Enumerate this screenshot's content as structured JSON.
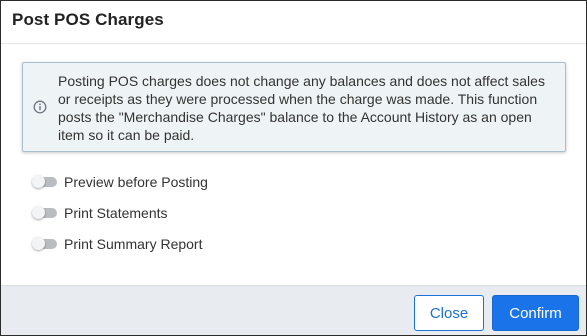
{
  "dialog": {
    "title": "Post POS Charges",
    "info": {
      "icon": "info-circle-icon",
      "text": "Posting POS charges does not change any balances and does not affect sales or receipts as they were processed when the charge was made. This function posts the \"Merchandise Charges\" balance to the Account History as an open item so it can be paid."
    },
    "options": [
      {
        "label": "Preview before Posting",
        "checked": false
      },
      {
        "label": "Print Statements",
        "checked": false
      },
      {
        "label": "Print Summary Report",
        "checked": false
      }
    ],
    "buttons": {
      "close_label": "Close",
      "confirm_label": "Confirm"
    },
    "colors": {
      "accent": "#1a73e8",
      "info_background": "#eef3f6",
      "footer_background": "#e8ebf0"
    }
  }
}
